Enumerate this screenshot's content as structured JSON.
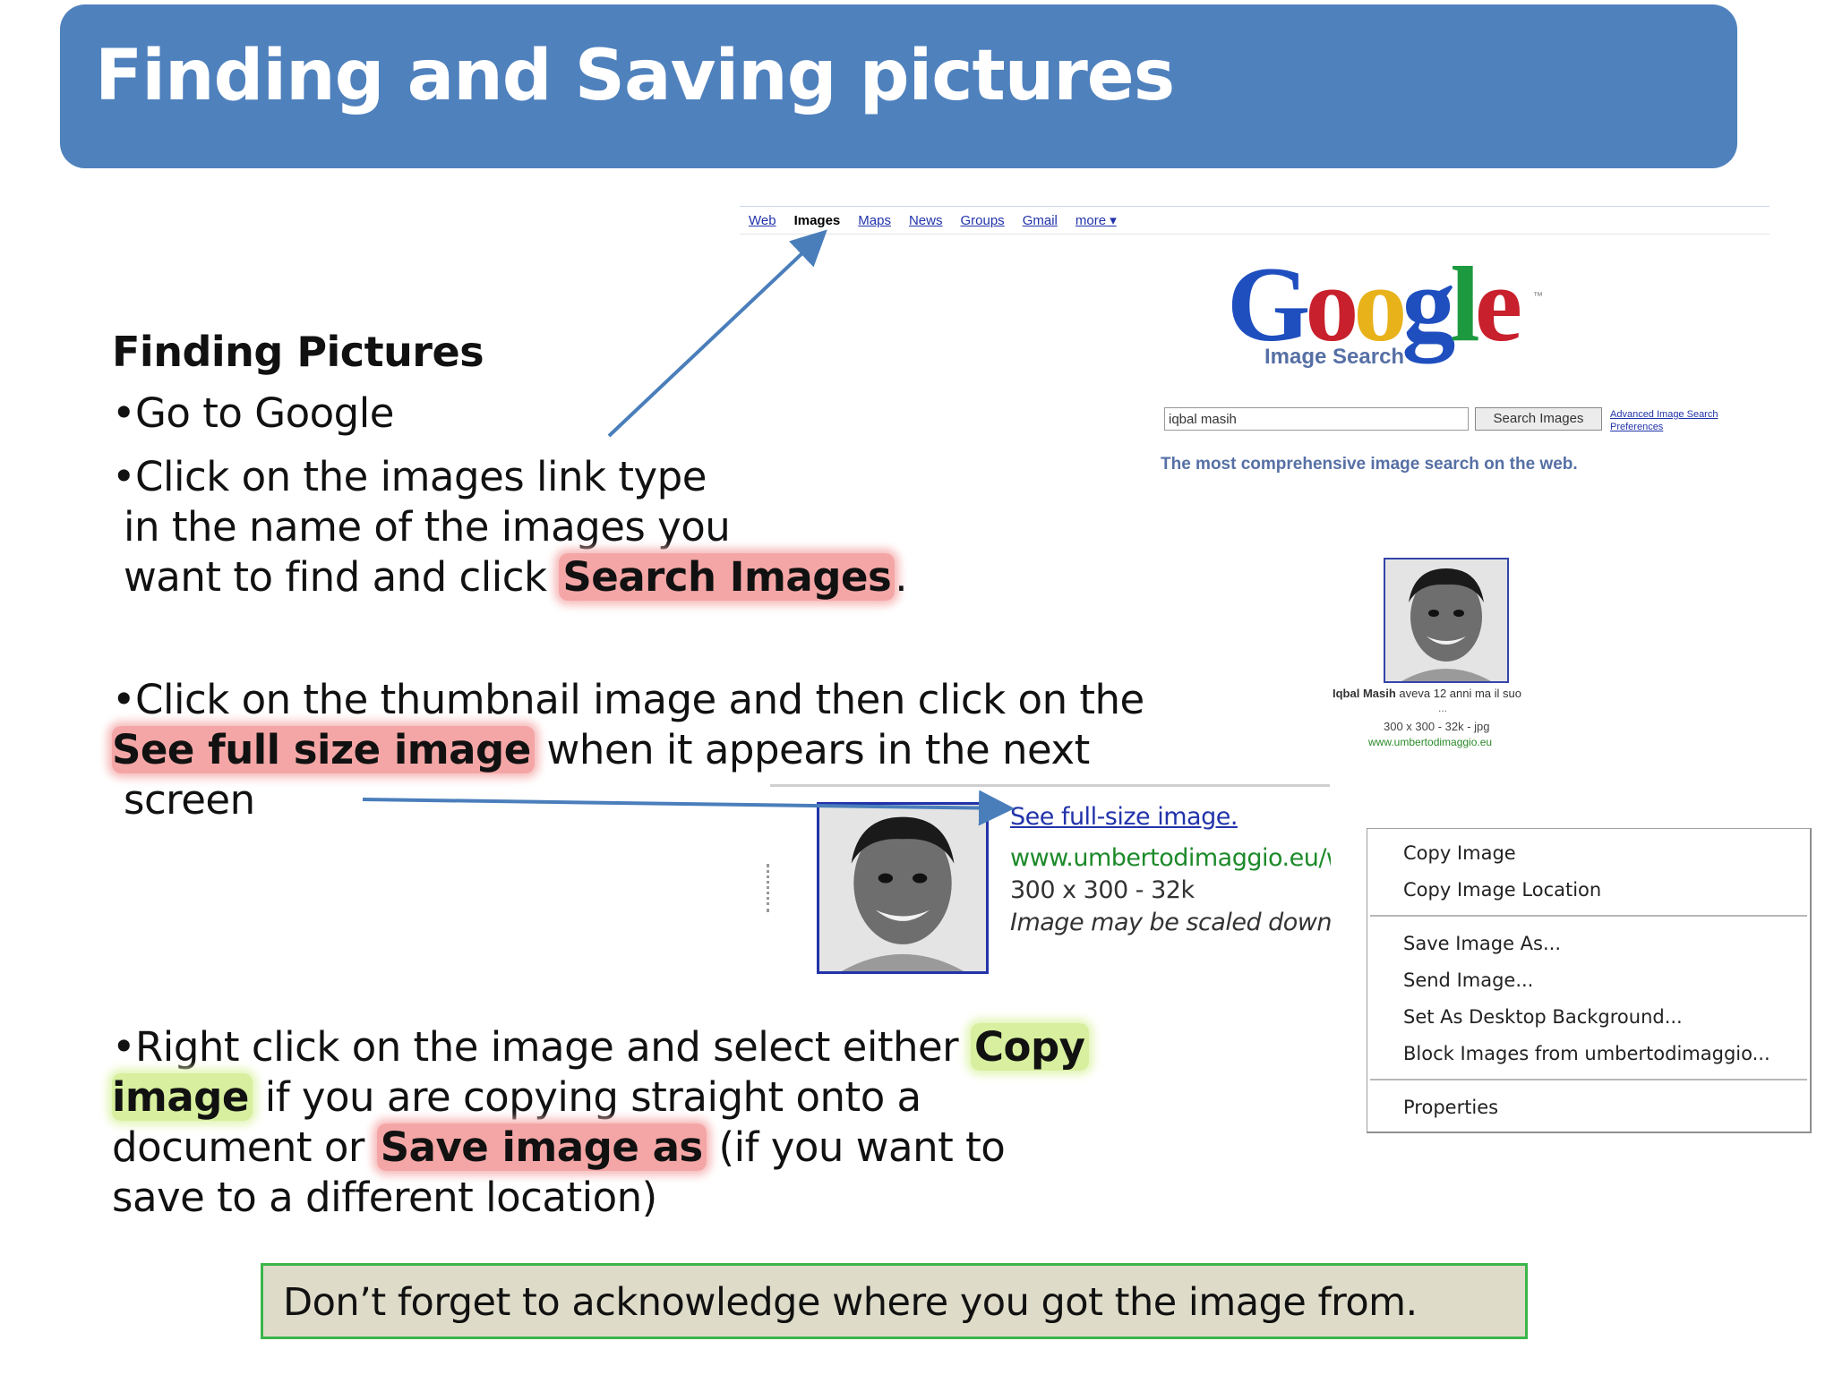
{
  "slide": {
    "title": "Finding and Saving pictures",
    "section_heading": "Finding Pictures",
    "bullet_go": "•Go to Google",
    "bullet_click_1": "•Click on the images link type",
    "bullet_click_2": "in the name of the images you",
    "bullet_click_3": "want to find and click ",
    "hl_search_images": "Search Images",
    "period": ".",
    "bullet_thumb_1": "•Click on the thumbnail image and then click on the",
    "hl_see_full": "See full size image",
    "bullet_thumb_2": " when it appears in the next",
    "bullet_thumb_3": "screen",
    "bullet_right_1": "•Right click on the image and select either ",
    "hl_copy": "Copy",
    "hl_image": "image",
    "bullet_right_2": " if you are copying straight onto a",
    "bullet_right_3": "document or ",
    "hl_save": "Save image as",
    "bullet_right_4": " (if you want to",
    "bullet_right_5": "save to a different location)",
    "footer": "Don’t forget to acknowledge where you got the image from."
  },
  "google": {
    "nav": [
      "Web",
      "Images",
      "Maps",
      "News",
      "Groups",
      "Gmail",
      "more ▾"
    ],
    "logo_letters": [
      "G",
      "o",
      "o",
      "g",
      "l",
      "e"
    ],
    "trademark": "™",
    "sub_label": "Image Search",
    "search_value": "iqbal masih",
    "search_button": "Search Images",
    "advanced_link": "Advanced Image Search",
    "preferences_link": "Preferences",
    "tagline": "The most comprehensive image search on the web.",
    "thumb_caption_bold": "Iqbal Masih",
    "thumb_caption_rest": " aveva 12 anni ma il suo",
    "thumb_caption_dots": "...",
    "thumb_size": "300 x 300 - 32k - jpg",
    "thumb_url": "www.umbertodimaggio.eu"
  },
  "fullsize": {
    "link": "See full-size image.",
    "url": "www.umbertodimaggio.eu/wp",
    "size": "300 x 300 - 32k",
    "note": "Image may be scaled down a"
  },
  "context_menu": {
    "items": [
      "Copy Image",
      "Copy Image Location",
      "Save Image As...",
      "Send Image...",
      "Set As Desktop Background...",
      "Block Images from umbertodimaggio...",
      "Properties"
    ]
  },
  "colors": {
    "title_bar": "#4f81bd",
    "red_highlight": "#f4a6a6",
    "green_highlight": "#d7ef9e",
    "footer_fill": "#dedcc9",
    "footer_border": "#3bb54a",
    "arrow": "#4a7ebb"
  },
  "icons": [
    "arrow-icon",
    "dropdown-caret-icon"
  ]
}
